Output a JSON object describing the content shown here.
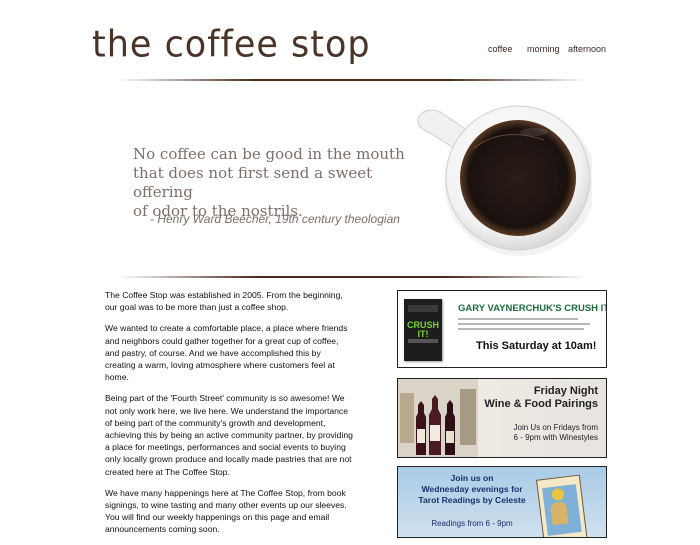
{
  "header": {
    "logo": "the coffee stop",
    "nav": [
      "coffee",
      "morning",
      "afternoon"
    ]
  },
  "hero": {
    "quote_lines": [
      "No coffee can be good in the mouth",
      "that does not first send a sweet offering",
      "of odor to the nostrils."
    ],
    "attribution": "- Henry Ward Beecher, 19th century theologian"
  },
  "content": {
    "paragraphs": [
      "The Coffee Stop was established in 2005. From the beginning, our goal was to be more than just a coffee shop.",
      "We wanted to create a comfortable place, a place where friends and neighbors could gather together for a great cup of coffee, and pastry, of course. And we have accomplished this by creating a warm, loving atmosphere where customers feel at home.",
      "Being part of the 'Fourth Street' community is so awesome! We not only work here, we live here. We understand the importance of being part of the community's growth and development, achieving this by being an active community partner, by providing a place for meetings, performances and social events to buying only locally grown produce and locally made pastries that are not created here at The Coffee Stop.",
      "We have many happenings here at The Coffee Stop, from book signings, to wine tasting and many other events up our sleeves. You will find our weekly happenings on this page and email announcements coming soon."
    ]
  },
  "ads": {
    "crush_it": {
      "book_title": "CRUSH IT!",
      "heading": "GARY VAYNERCHUK'S CRUSH IT!",
      "cta": "This Saturday at 10am!"
    },
    "wine": {
      "title_line1": "Friday Night",
      "title_line2": "Wine & Food Pairings",
      "sub_line1": "Join Us on Fridays from",
      "sub_line2": "6 - 9pm with Winestyles"
    },
    "tarot": {
      "line1": "Join us on",
      "line2": "Wednesday evenings for",
      "line3": "Tarot Readings by Celeste",
      "sub": "Readings from 6 - 9pm"
    }
  },
  "colors": {
    "logo": "#4a3328",
    "quote": "#7d6f69",
    "accent_green": "#1b6b3a",
    "tarot_text": "#1b2f6a"
  }
}
